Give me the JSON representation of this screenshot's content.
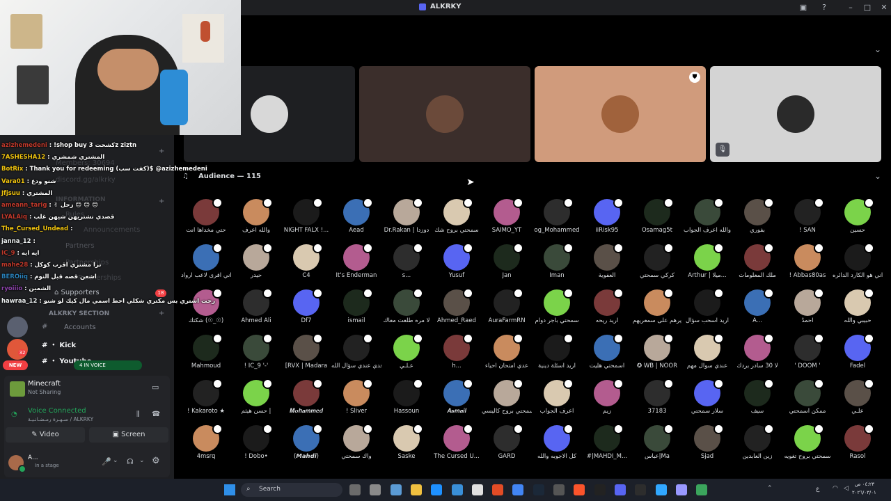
{
  "window": {
    "title": "ALKRKY"
  },
  "colors": {
    "accent": "#5865f2",
    "green": "#23a55a",
    "red": "#f23f43",
    "bg": "#000000"
  },
  "speakers": [
    {
      "name": "",
      "bg": "#1e1f22",
      "avatar_color": "#d8d8d8"
    },
    {
      "name": "",
      "bg": "#3b2e2b",
      "avatar_color": "#6b4a3a"
    },
    {
      "name": "",
      "bg": "#d09b7c",
      "avatar_color": "#a0623c"
    },
    {
      "name": "",
      "bg": "#d4d4d4",
      "avatar_color": "#2a2a2a"
    }
  ],
  "audience": {
    "label": "Audience — 115",
    "rows": [
      [
        "حتي مخداها انت",
        "والله اعرف",
        "NIGHT FALX !...",
        "Aead",
        "Dr.Rakan | دوزدا",
        "سمحتي بروح شك",
        "SAIMO_YT",
        "og_Mohammed",
        "iiRisk95",
        "Osamag5t",
        "والله اعرف الجواب",
        "بفوري",
        "! SAN",
        "حسين"
      ],
      [
        "اني اقرى لاعب ارواد",
        "حيدر",
        "C4",
        "It's Enderman",
        "s...",
        "Yusuf",
        "Jan",
        "Iman",
        "العفوية",
        "كركي سمحتي",
        "Arthur | ميلا...",
        "ملك المعلومات",
        "! Abbas80as",
        "اني هو الكارد الدائره"
      ],
      [
        "شكتك (☉_☉)",
        "Ahmed Ali",
        "Df7",
        "ismail",
        "لا مره طلعت معاك",
        "Ahmed_Raed",
        "AuraFarmRN",
        "سمحتي باجر دوام",
        "اريد ريحه",
        "يرهم على سمعريهم",
        "اريد اسحب سؤال",
        "A...",
        "احمدُ",
        "حبيبي والله"
      ],
      [
        "Mahmoud",
        "! IC_9 '-'",
        "[RVX | Madara",
        "عدي عندي سؤال الله",
        "عـلـي",
        "h...",
        "عدي امتحان احياء",
        "اريد اسئلة دينية",
        "اسمحتي هليت",
        "✪ WB | NOOR",
        "عندي سوال مهم",
        "لا 30 سادر بردك",
        "' DOOM '",
        "Fadel"
      ],
      [
        "! Kakaroto ★",
        "حسن هيثم |",
        "𝑴𝒐𝒉𝒂𝒎𝒎𝒆𝒅",
        "! Sliver",
        "Hassoun",
        "𝑨𝒔𝒎𝒂𝒊𝒍",
        "سمحتي بروح كاليسي",
        "اعرف الجواب",
        "زيم",
        "37183",
        "سلار سمحتي",
        "سيف",
        "ممكن اسمحتي",
        "علـي"
      ],
      [
        "4msrq",
        "! Dobo•",
        "(𝙈𝙖𝙝𝙙𝙞)",
        "واك سمحتي",
        "Saske",
        "The Cursed U...",
        "GARD",
        "كل الاجوبه والله",
        "#|MAHDI_M...",
        "عباس|Ma",
        "Sjad",
        "زين العابدين",
        "سمحتي بروح تغويه",
        "Rasol"
      ]
    ],
    "colors": [
      "#7a3a3a",
      "#c98b5e",
      "#1b1b1b",
      "#3b6fb5",
      "#b8a89a",
      "#d9c9b0",
      "#b35c8f",
      "#2d2d2d",
      "#5865f2",
      "#1d2a1d",
      "#3a4a3a",
      "#5a5048",
      "#222",
      "#7bd34a"
    ]
  },
  "sidebar": {
    "server_items": [
      "# ・ Kick",
      "# ・ Youtube"
    ],
    "section": "ALKRKY SECTION",
    "accounts": "Accounts",
    "supporters": {
      "label": "Supporters",
      "count": "18"
    },
    "partners": "Partners",
    "in_voice": "4 IN VOICE",
    "new_badge": "NEW",
    "ghost_lines": [
      "Members: 30694",
      "discord.gg/alkrky",
      "INFORMATION",
      "Rules",
      "Announcements",
      "Partners",
      "Partnerships"
    ]
  },
  "chat": [
    {
      "user": "azizhemedeni",
      "text": ": !shop buy 3 كشحتz ziztn",
      "color": "#c0392b"
    },
    {
      "user": "7ASHESHA12",
      "text": ": المشتري شمشري",
      "color": "#f1c40f"
    },
    {
      "user": "BotRix",
      "text": ": Thank you for redeeming (كفت سب)$ @azizhemedeni",
      "color": "#f1c40f"
    },
    {
      "user": "Vara01",
      "text": ": شنو ودع",
      "color": "#f1c40f"
    },
    {
      "user": "Jfjsuu",
      "text": ": المشتري",
      "color": "#f1c40f"
    },
    {
      "user": "ameann_tarig",
      "text": ": ✌ زحل 😊 😊 😊",
      "color": "#c0392b"
    },
    {
      "user": "LYALAiq",
      "text": ": قصدي تشتريهن شيهن غلب",
      "color": "#c0392b"
    },
    {
      "user": "The_Cursed_Undead",
      "text": ":",
      "color": "#f1c40f"
    },
    {
      "user": "janna_12",
      "text": ":",
      "color": "#ecf0f1"
    },
    {
      "user": "IC_9",
      "text": ": ايه ايه",
      "color": "#c0392b"
    },
    {
      "user": "mahe28",
      "text": ": ترا مشتري اقرب كوكل",
      "color": "#c0392b"
    },
    {
      "user": "BEROiiq",
      "text": ": اشعن قصه قبل النوم",
      "color": "#2980b9"
    },
    {
      "user": "ryoiiio",
      "text": ": الشمين",
      "color": "#8e44ad"
    },
    {
      "user": "hawraa_12",
      "text": ": رحت اشتري بس مكتري شكلي احط اسمي مال كيك لو شنو",
      "color": "#ecf0f1"
    }
  ],
  "activity": {
    "title": "Minecraft",
    "subtitle": "Not Sharing"
  },
  "voice": {
    "status": "Voice Connected",
    "location": "سـهـرة رمـضـانـيـة / ALKRKY"
  },
  "buttons": {
    "video": "Video",
    "screen": "Screen"
  },
  "user": {
    "name": "A...",
    "status": "In a stage"
  },
  "taskbar": {
    "search_placeholder": "Search",
    "lang": "ع",
    "time": "٠٤:٢٣ ص",
    "date": "٢٠٢٦/٠٣/٠١"
  }
}
